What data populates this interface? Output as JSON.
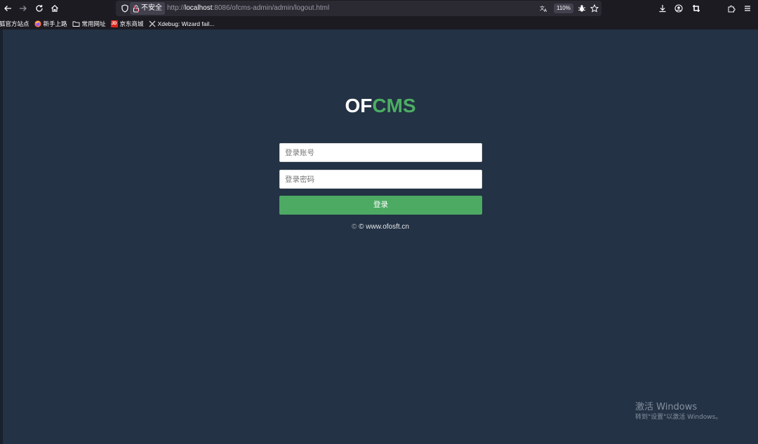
{
  "browser": {
    "security_label": "不安全",
    "url_prefix": "http://",
    "url_host": "localhost",
    "url_rest": ":8086/ofcms-admin/admin/logout.html",
    "zoom": "110%",
    "bookmarks": [
      {
        "label": "狐官方站点",
        "icon": "none"
      },
      {
        "label": "新手上路",
        "icon": "firefox-icon"
      },
      {
        "label": "常用网址",
        "icon": "folder-icon"
      },
      {
        "label": "京东商城",
        "icon": "jd-icon",
        "icon_text": "JD"
      },
      {
        "label": "Xdebug: Wizard fail...",
        "icon": "xdebug-icon"
      }
    ]
  },
  "login": {
    "logo_part1": "OF",
    "logo_part2": "CMS",
    "username_placeholder": "登录账号",
    "password_placeholder": "登录密码",
    "submit_label": "登录",
    "copyright_symbol": "©",
    "copyright_text": "© www.ofosft.cn"
  },
  "watermark": {
    "title": "激活 Windows",
    "subtitle": "转到\"设置\"以激活 Windows。"
  },
  "colors": {
    "page_bg": "#233244",
    "accent": "#4caa63",
    "logo_cms": "#4cae63"
  }
}
